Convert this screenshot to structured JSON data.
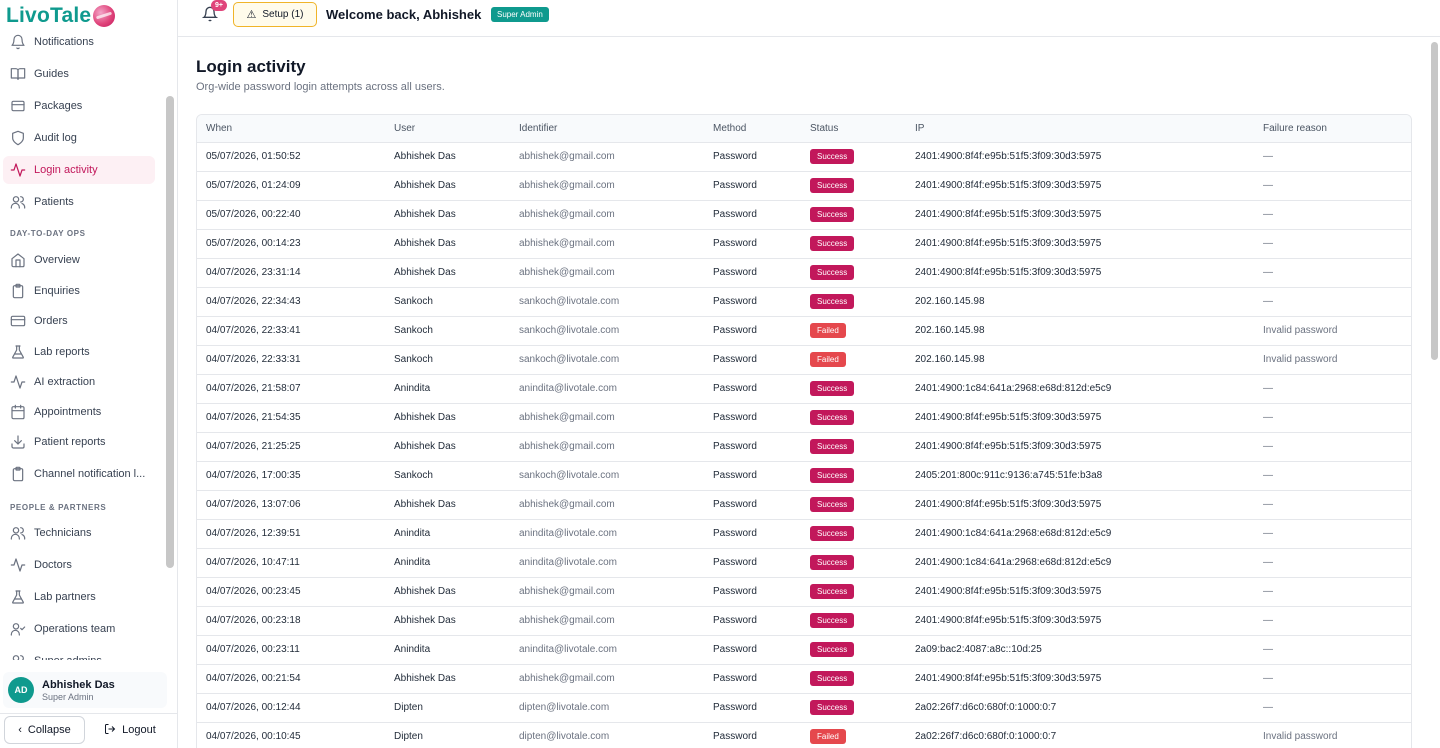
{
  "brand": {
    "name": "LivoTale"
  },
  "header": {
    "notification_count": "9+",
    "setup_label": "Setup (1)",
    "welcome": "Welcome back, Abhishek",
    "role_badge": "Super Admin"
  },
  "sidebar": {
    "items": [
      {
        "label": "Notifications",
        "icon": "bell-icon"
      },
      {
        "label": "Guides",
        "icon": "book-icon"
      },
      {
        "label": "Packages",
        "icon": "package-icon"
      },
      {
        "label": "Audit log",
        "icon": "shield-icon"
      },
      {
        "label": "Login activity",
        "icon": "activity-icon",
        "active": true
      },
      {
        "label": "Patients",
        "icon": "users-icon"
      }
    ],
    "section_ops": "DAY-TO-DAY OPS",
    "ops_items": [
      {
        "label": "Overview",
        "icon": "home-icon"
      },
      {
        "label": "Enquiries",
        "icon": "clipboard-icon"
      },
      {
        "label": "Orders",
        "icon": "card-icon"
      },
      {
        "label": "Lab reports",
        "icon": "flask-icon"
      },
      {
        "label": "AI extraction",
        "icon": "activity-icon"
      },
      {
        "label": "Appointments",
        "icon": "calendar-icon"
      },
      {
        "label": "Patient reports",
        "icon": "download-icon"
      },
      {
        "label": "Channel notification l...",
        "icon": "clipboard-icon"
      }
    ],
    "section_people": "PEOPLE & PARTNERS",
    "people_items": [
      {
        "label": "Technicians",
        "icon": "users-icon"
      },
      {
        "label": "Doctors",
        "icon": "activity-icon"
      },
      {
        "label": "Lab partners",
        "icon": "flask-icon"
      },
      {
        "label": "Operations team",
        "icon": "user-check-icon"
      },
      {
        "label": "Super admins",
        "icon": "users-icon"
      }
    ],
    "user": {
      "initials": "AD",
      "name": "Abhishek Das",
      "role": "Super Admin"
    },
    "collapse_label": "Collapse",
    "logout_label": "Logout"
  },
  "page": {
    "title": "Login activity",
    "subtitle": "Org-wide password login attempts across all users."
  },
  "table": {
    "columns": [
      "When",
      "User",
      "Identifier",
      "Method",
      "Status",
      "IP",
      "Failure reason"
    ],
    "rows": [
      {
        "when": "05/07/2026, 01:50:52",
        "user": "Abhishek Das",
        "identifier": "abhishek@gmail.com",
        "method": "Password",
        "status": "Success",
        "ip": "2401:4900:8f4f:e95b:51f5:3f09:30d3:5975",
        "reason": "—"
      },
      {
        "when": "05/07/2026, 01:24:09",
        "user": "Abhishek Das",
        "identifier": "abhishek@gmail.com",
        "method": "Password",
        "status": "Success",
        "ip": "2401:4900:8f4f:e95b:51f5:3f09:30d3:5975",
        "reason": "—"
      },
      {
        "when": "05/07/2026, 00:22:40",
        "user": "Abhishek Das",
        "identifier": "abhishek@gmail.com",
        "method": "Password",
        "status": "Success",
        "ip": "2401:4900:8f4f:e95b:51f5:3f09:30d3:5975",
        "reason": "—"
      },
      {
        "when": "05/07/2026, 00:14:23",
        "user": "Abhishek Das",
        "identifier": "abhishek@gmail.com",
        "method": "Password",
        "status": "Success",
        "ip": "2401:4900:8f4f:e95b:51f5:3f09:30d3:5975",
        "reason": "—"
      },
      {
        "when": "04/07/2026, 23:31:14",
        "user": "Abhishek Das",
        "identifier": "abhishek@gmail.com",
        "method": "Password",
        "status": "Success",
        "ip": "2401:4900:8f4f:e95b:51f5:3f09:30d3:5975",
        "reason": "—"
      },
      {
        "when": "04/07/2026, 22:34:43",
        "user": "Sankoch",
        "identifier": "sankoch@livotale.com",
        "method": "Password",
        "status": "Success",
        "ip": "202.160.145.98",
        "reason": "—"
      },
      {
        "when": "04/07/2026, 22:33:41",
        "user": "Sankoch",
        "identifier": "sankoch@livotale.com",
        "method": "Password",
        "status": "Failed",
        "ip": "202.160.145.98",
        "reason": "Invalid password"
      },
      {
        "when": "04/07/2026, 22:33:31",
        "user": "Sankoch",
        "identifier": "sankoch@livotale.com",
        "method": "Password",
        "status": "Failed",
        "ip": "202.160.145.98",
        "reason": "Invalid password"
      },
      {
        "when": "04/07/2026, 21:58:07",
        "user": "Anindita",
        "identifier": "anindita@livotale.com",
        "method": "Password",
        "status": "Success",
        "ip": "2401:4900:1c84:641a:2968:e68d:812d:e5c9",
        "reason": "—"
      },
      {
        "when": "04/07/2026, 21:54:35",
        "user": "Abhishek Das",
        "identifier": "abhishek@gmail.com",
        "method": "Password",
        "status": "Success",
        "ip": "2401:4900:8f4f:e95b:51f5:3f09:30d3:5975",
        "reason": "—"
      },
      {
        "when": "04/07/2026, 21:25:25",
        "user": "Abhishek Das",
        "identifier": "abhishek@gmail.com",
        "method": "Password",
        "status": "Success",
        "ip": "2401:4900:8f4f:e95b:51f5:3f09:30d3:5975",
        "reason": "—"
      },
      {
        "when": "04/07/2026, 17:00:35",
        "user": "Sankoch",
        "identifier": "sankoch@livotale.com",
        "method": "Password",
        "status": "Success",
        "ip": "2405:201:800c:911c:9136:a745:51fe:b3a8",
        "reason": "—"
      },
      {
        "when": "04/07/2026, 13:07:06",
        "user": "Abhishek Das",
        "identifier": "abhishek@gmail.com",
        "method": "Password",
        "status": "Success",
        "ip": "2401:4900:8f4f:e95b:51f5:3f09:30d3:5975",
        "reason": "—"
      },
      {
        "when": "04/07/2026, 12:39:51",
        "user": "Anindita",
        "identifier": "anindita@livotale.com",
        "method": "Password",
        "status": "Success",
        "ip": "2401:4900:1c84:641a:2968:e68d:812d:e5c9",
        "reason": "—"
      },
      {
        "when": "04/07/2026, 10:47:11",
        "user": "Anindita",
        "identifier": "anindita@livotale.com",
        "method": "Password",
        "status": "Success",
        "ip": "2401:4900:1c84:641a:2968:e68d:812d:e5c9",
        "reason": "—"
      },
      {
        "when": "04/07/2026, 00:23:45",
        "user": "Abhishek Das",
        "identifier": "abhishek@gmail.com",
        "method": "Password",
        "status": "Success",
        "ip": "2401:4900:8f4f:e95b:51f5:3f09:30d3:5975",
        "reason": "—"
      },
      {
        "when": "04/07/2026, 00:23:18",
        "user": "Abhishek Das",
        "identifier": "abhishek@gmail.com",
        "method": "Password",
        "status": "Success",
        "ip": "2401:4900:8f4f:e95b:51f5:3f09:30d3:5975",
        "reason": "—"
      },
      {
        "when": "04/07/2026, 00:23:11",
        "user": "Anindita",
        "identifier": "anindita@livotale.com",
        "method": "Password",
        "status": "Success",
        "ip": "2a09:bac2:4087:a8c::10d:25",
        "reason": "—"
      },
      {
        "when": "04/07/2026, 00:21:54",
        "user": "Abhishek Das",
        "identifier": "abhishek@gmail.com",
        "method": "Password",
        "status": "Success",
        "ip": "2401:4900:8f4f:e95b:51f5:3f09:30d3:5975",
        "reason": "—"
      },
      {
        "when": "04/07/2026, 00:12:44",
        "user": "Dipten",
        "identifier": "dipten@livotale.com",
        "method": "Password",
        "status": "Success",
        "ip": "2a02:26f7:d6c0:680f:0:1000:0:7",
        "reason": "—"
      },
      {
        "when": "04/07/2026, 00:10:45",
        "user": "Dipten",
        "identifier": "dipten@livotale.com",
        "method": "Password",
        "status": "Failed",
        "ip": "2a02:26f7:d6c0:680f:0:1000:0:7",
        "reason": "Invalid password"
      }
    ]
  },
  "colors": {
    "brand_teal": "#0f9a8e",
    "brand_pink": "#c2185b",
    "failed_red": "#e5484d"
  }
}
